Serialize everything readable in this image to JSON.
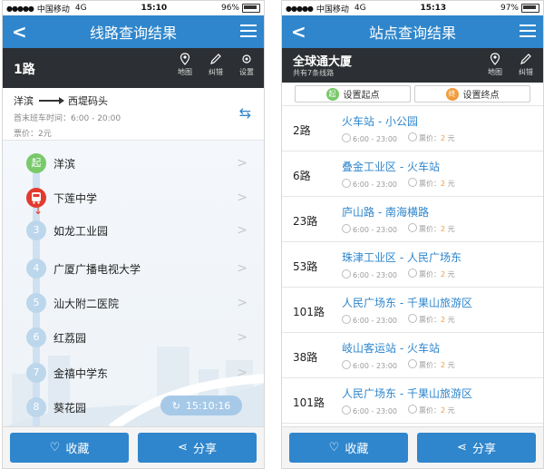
{
  "left": {
    "status": {
      "carrier": "中国移动",
      "network": "4G",
      "time": "15:10",
      "battery": "96%"
    },
    "nav": {
      "title": "线路查询结果"
    },
    "route": {
      "number": "1路"
    },
    "tools": {
      "map": "地图",
      "correct": "纠错",
      "settings": "设置"
    },
    "direction": {
      "from": "洋滨",
      "to": "西堤码头",
      "hours_label": "首末班车时间：",
      "hours": "6:00 - 20:00",
      "price_label": "票价：",
      "price": "2元"
    },
    "stops": [
      {
        "marker": "起",
        "name": "洋滨"
      },
      {
        "marker": "",
        "name": "下莲中学"
      },
      {
        "marker": "3",
        "name": "如龙工业园"
      },
      {
        "marker": "4",
        "name": "广厦广播电视大学"
      },
      {
        "marker": "5",
        "name": "汕大附二医院"
      },
      {
        "marker": "6",
        "name": "红荔园"
      },
      {
        "marker": "7",
        "name": "金禧中学东"
      },
      {
        "marker": "8",
        "name": "葵花园"
      }
    ],
    "refresh_time": "15:10:16",
    "buttons": {
      "favorite": "收藏",
      "share": "分享"
    }
  },
  "right": {
    "status": {
      "carrier": "中国移动",
      "network": "4G",
      "time": "15:13",
      "battery": "97%"
    },
    "nav": {
      "title": "站点查询结果"
    },
    "station": {
      "name": "全球通大厦",
      "sub": "共有7条线路"
    },
    "tools": {
      "map": "地图",
      "correct": "纠错"
    },
    "set": {
      "start": "设置起点",
      "end": "设置终点",
      "start_badge": "起",
      "end_badge": "终"
    },
    "routes": [
      {
        "no": "2路",
        "title": "火车站 - 小公园",
        "time": "6:00 - 23:00",
        "price_label": "票价：",
        "price": "2",
        "unit": "元"
      },
      {
        "no": "6路",
        "title": "叠金工业区 - 火车站",
        "time": "6:00 - 23:00",
        "price_label": "票价：",
        "price": "2",
        "unit": "元"
      },
      {
        "no": "23路",
        "title": "庐山路 - 南海横路",
        "time": "6:00 - 23:00",
        "price_label": "票价：",
        "price": "2",
        "unit": "元"
      },
      {
        "no": "53路",
        "title": "珠津工业区 - 人民广场东",
        "time": "6:00 - 23:00",
        "price_label": "票价：",
        "price": "2",
        "unit": "元"
      },
      {
        "no": "101路",
        "title": "人民广场东 - 千果山旅游区",
        "time": "6:00 - 23:00",
        "price_label": "票价：",
        "price": "2",
        "unit": "元"
      },
      {
        "no": "38路",
        "title": "岐山客运站 - 火车站",
        "time": "6:00 - 23:00",
        "price_label": "票价：",
        "price": "2",
        "unit": "元"
      },
      {
        "no": "101路",
        "title": "人民广场东 - 千果山旅游区",
        "time": "6:00 - 23:00",
        "price_label": "票价：",
        "price": "2",
        "unit": "元"
      }
    ],
    "buttons": {
      "favorite": "收藏",
      "share": "分享"
    }
  }
}
